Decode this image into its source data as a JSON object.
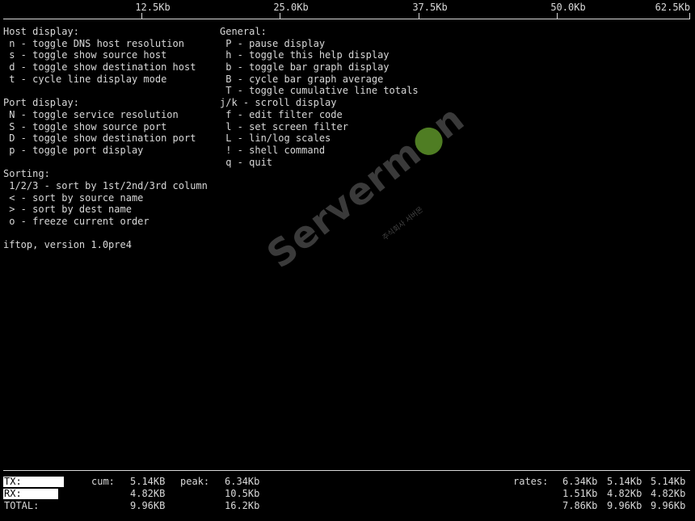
{
  "scale": {
    "ticks": [
      "12.5Kb",
      "25.0Kb",
      "37.5Kb",
      "50.0Kb",
      "62.5Kb"
    ]
  },
  "help": {
    "left": [
      "Host display:",
      " n - toggle DNS host resolution",
      " s - toggle show source host",
      " d - toggle show destination host",
      " t - cycle line display mode",
      "",
      "Port display:",
      " N - toggle service resolution",
      " S - toggle show source port",
      " D - toggle show destination port",
      " p - toggle port display",
      "",
      "Sorting:",
      " 1/2/3 - sort by 1st/2nd/3rd column",
      " < - sort by source name",
      " > - sort by dest name",
      " o - freeze current order",
      "",
      "iftop, version 1.0pre4"
    ],
    "right": [
      "General:",
      " P - pause display",
      " h - toggle this help display",
      " b - toggle bar graph display",
      " B - cycle bar graph average",
      " T - toggle cumulative line totals",
      "j/k - scroll display",
      " f - edit filter code",
      " l - set screen filter",
      " L - lin/log scales",
      " ! - shell command",
      " q - quit"
    ]
  },
  "watermark": {
    "text_before": "Serverm",
    "text_after": "n",
    "sub": "주식회사 서버몬"
  },
  "totals": {
    "tx": {
      "label": "TX:",
      "cum": "5.14KB",
      "peak": "6.34Kb",
      "rates": [
        "6.34Kb",
        "5.14Kb",
        "5.14Kb"
      ]
    },
    "rx": {
      "label": "RX:",
      "cum": "4.82KB",
      "peak": "10.5Kb",
      "rates": [
        "1.51Kb",
        "4.82Kb",
        "4.82Kb"
      ]
    },
    "total": {
      "label": "TOTAL:",
      "cum": "9.96KB",
      "peak": "16.2Kb",
      "rates": [
        "7.86Kb",
        "9.96Kb",
        "9.96Kb"
      ]
    },
    "cum_label": "cum:",
    "peak_label": "peak:",
    "rates_label": "rates:"
  },
  "colors": {
    "background": "#000000",
    "foreground": "#d8d8d8",
    "watermark_accent": "#4f7d23"
  }
}
